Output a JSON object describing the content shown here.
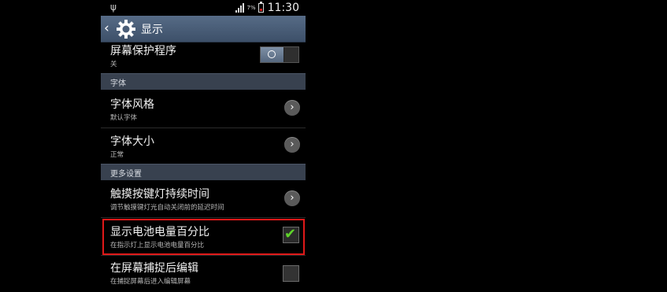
{
  "status_bar": {
    "battery_percent": "7%",
    "time": "11:30",
    "usb_icon": "usb-icon",
    "signal_icon": "signal-icon",
    "battery_icon": "battery-low-icon"
  },
  "action_bar": {
    "title": "显示",
    "back_icon": "chevron-left-icon",
    "app_icon": "gear-icon"
  },
  "settings": {
    "screensaver": {
      "title": "屏幕保护程序",
      "subtitle": "关",
      "toggle_on": false
    },
    "font_section": "字体",
    "font_style": {
      "title": "字体风格",
      "subtitle": "默认字体"
    },
    "font_size": {
      "title": "字体大小",
      "subtitle": "正常"
    },
    "more_section": "更多设置",
    "key_light": {
      "title": "触摸按键灯持续时间",
      "subtitle": "调节触摸键灯光自动关闭前的延迟时间"
    },
    "battery_percent": {
      "title": "显示电池电量百分比",
      "subtitle": "在指示灯上显示电池电量百分比",
      "checked": true
    },
    "screen_capture": {
      "title": "在屏幕捕捉后编辑",
      "subtitle": "在捕捉屏幕后进入编辑屏幕",
      "checked": false
    }
  },
  "colors": {
    "highlight_border": "#e01919",
    "check_green": "#5fd32a",
    "action_bar": "#4a5d77"
  }
}
